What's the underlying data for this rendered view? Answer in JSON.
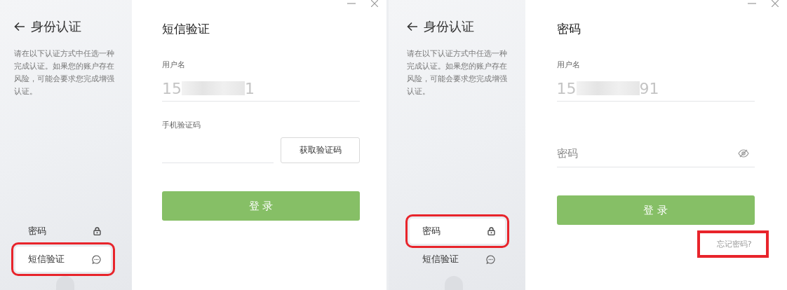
{
  "panels": [
    {
      "sidebar": {
        "title": "身份认证",
        "description": "请在以下认证方式中任选一种完成认证。如果您的账户存在风险，可能会要求您完成增强认证。",
        "methods": [
          {
            "label": "密码",
            "selected": false,
            "highlighted": false
          },
          {
            "label": "短信验证",
            "selected": true,
            "highlighted": true
          }
        ]
      },
      "form": {
        "title": "短信验证",
        "fields": [
          {
            "kind": "username",
            "label": "用户名",
            "value_start": "15",
            "value_end": "1"
          },
          {
            "kind": "code",
            "label": "手机验证码",
            "button": "获取验证码"
          }
        ],
        "submit": {
          "label": "登 录",
          "disabled": true
        }
      }
    },
    {
      "sidebar": {
        "title": "身份认证",
        "description": "请在以下认证方式中任选一种完成认证。如果您的账户存在风险，可能会要求您完成增强认证。",
        "methods": [
          {
            "label": "密码",
            "selected": true,
            "highlighted": true
          },
          {
            "label": "短信验证",
            "selected": false,
            "highlighted": false
          }
        ]
      },
      "form": {
        "title": "密码",
        "fields": [
          {
            "kind": "username",
            "label": "用户名",
            "value_start": "15",
            "value_end": "91"
          },
          {
            "kind": "password",
            "placeholder": "密码"
          }
        ],
        "submit": {
          "label": "登 录",
          "disabled": true
        },
        "forgot_link": {
          "label": "忘记密码?",
          "highlighted": true
        }
      }
    }
  ]
}
